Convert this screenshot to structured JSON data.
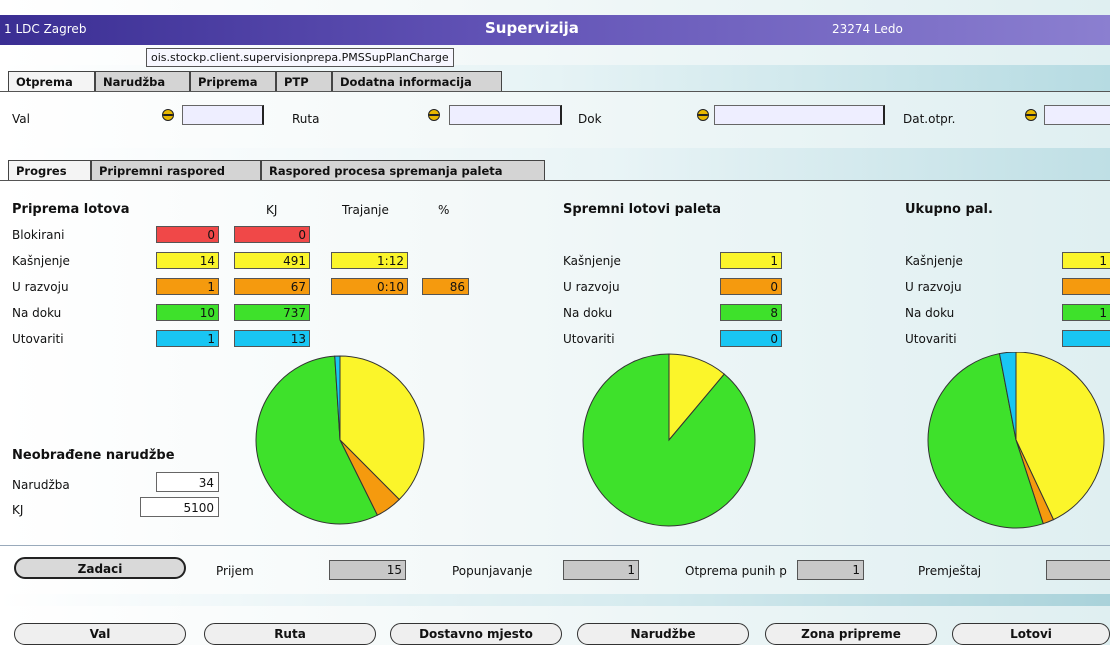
{
  "window": {
    "location": "1 LDC Zagreb",
    "title": "Supervizija",
    "user": "23274 Ledo",
    "tooltip": "ois.stockp.client.supervisionprepa.PMSSupPlanCharge"
  },
  "main_tabs": [
    "Otprema",
    "Narudžba",
    "Priprema",
    "PTP",
    "Dodatna informacija"
  ],
  "filters": {
    "val_label": "Val",
    "ruta_label": "Ruta",
    "dok_label": "Dok",
    "dat_label": "Dat.otpr."
  },
  "sub_tabs": [
    "Progres",
    "Pripremni raspored",
    "Raspored procesa spremanja paleta"
  ],
  "priprema": {
    "title": "Priprema lotova",
    "headers": {
      "kj": "KJ",
      "trajanje": "Trajanje",
      "pct": "%"
    },
    "rows": [
      {
        "label": "Blokirani",
        "count": "0",
        "kj": "0",
        "color": "red"
      },
      {
        "label": "Kašnjenje",
        "count": "14",
        "kj": "491",
        "trajanje": "1:12",
        "color": "yellow"
      },
      {
        "label": "U razvoju",
        "count": "1",
        "kj": "67",
        "trajanje": "0:10",
        "pct": "86",
        "color": "orange"
      },
      {
        "label": "Na doku",
        "count": "10",
        "kj": "737",
        "color": "green"
      },
      {
        "label": "Utovariti",
        "count": "1",
        "kj": "13",
        "color": "cyan"
      }
    ]
  },
  "spremni": {
    "title": "Spremni lotovi paleta",
    "rows": [
      {
        "label": "Kašnjenje",
        "value": "1",
        "color": "yellow"
      },
      {
        "label": "U razvoju",
        "value": "0",
        "color": "orange"
      },
      {
        "label": "Na doku",
        "value": "8",
        "color": "green"
      },
      {
        "label": "Utovariti",
        "value": "0",
        "color": "cyan"
      }
    ]
  },
  "ukupno": {
    "title": "Ukupno pal.",
    "rows": [
      {
        "label": "Kašnjenje",
        "value": "1",
        "color": "yellow"
      },
      {
        "label": "U razvoju",
        "value": "",
        "color": "orange"
      },
      {
        "label": "Na doku",
        "value": "1",
        "color": "green"
      },
      {
        "label": "Utovariti",
        "value": "",
        "color": "cyan"
      }
    ]
  },
  "pies": {
    "colors": {
      "yellow": "#fbf52a",
      "orange": "#f59a0e",
      "green": "#3ee12b",
      "cyan": "#19c6f3"
    },
    "priprema_kj": [
      {
        "name": "Kašnjenje",
        "value": 491,
        "color": "yellow"
      },
      {
        "name": "U razvoju",
        "value": 67,
        "color": "orange"
      },
      {
        "name": "Na doku",
        "value": 737,
        "color": "green"
      },
      {
        "name": "Utovariti",
        "value": 13,
        "color": "cyan"
      }
    ],
    "spremni": [
      {
        "name": "Kašnjenje",
        "value": 1,
        "color": "yellow"
      },
      {
        "name": "U razvoju",
        "value": 0,
        "color": "orange"
      },
      {
        "name": "Na doku",
        "value": 8,
        "color": "green"
      },
      {
        "name": "Utovariti",
        "value": 0,
        "color": "cyan"
      }
    ],
    "ukupno": [
      {
        "name": "Kašnjenje",
        "value": 43,
        "color": "yellow"
      },
      {
        "name": "U razvoju",
        "value": 2,
        "color": "orange"
      },
      {
        "name": "Na doku",
        "value": 52,
        "color": "green"
      },
      {
        "name": "Utovariti",
        "value": 3,
        "color": "cyan"
      }
    ]
  },
  "neobradene": {
    "title": "Neobrađene narudžbe",
    "narudzba_label": "Narudžba",
    "narudzba_value": "34",
    "kj_label": "KJ",
    "kj_value": "5100"
  },
  "status": {
    "zadaci": "Zadaci",
    "prijem_label": "Prijem",
    "prijem_value": "15",
    "popunjavanje_label": "Popunjavanje",
    "popunjavanje_value": "1",
    "otprema_label": "Otprema punih p",
    "otprema_value": "1",
    "premjestaj_label": "Premještaj",
    "premjestaj_value": ""
  },
  "bottom_buttons": [
    "Val",
    "Ruta",
    "Dostavno mjesto",
    "Narudžbe",
    "Zona pripreme",
    "Lotovi"
  ]
}
